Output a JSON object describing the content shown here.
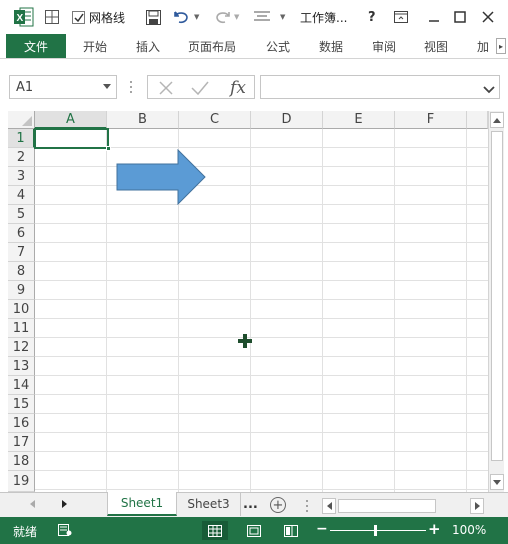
{
  "titlebar": {
    "gridlines_checkbox_label": "网格线",
    "gridlines_checked": true,
    "doc_title": "工作簿...",
    "help": "?"
  },
  "ribbon": {
    "tabs": [
      "文件",
      "开始",
      "插入",
      "页面布局",
      "公式",
      "数据",
      "审阅",
      "视图",
      "加"
    ]
  },
  "formula_bar": {
    "name_box": "A1",
    "fx_label": "fx",
    "formula": ""
  },
  "grid": {
    "columns": [
      "A",
      "B",
      "C",
      "D",
      "E",
      "F"
    ],
    "rows": [
      "1",
      "2",
      "3",
      "4",
      "5",
      "6",
      "7",
      "8",
      "9",
      "10",
      "11",
      "12",
      "13",
      "14",
      "15",
      "16",
      "17",
      "18",
      "19"
    ],
    "selected_cell": "A1",
    "shape": "right-arrow",
    "shape_color": "#5b9bd5"
  },
  "sheets": {
    "tabs": [
      "Sheet1",
      "Sheet3"
    ],
    "active": "Sheet1",
    "more": "..."
  },
  "status": {
    "text": "就绪",
    "zoom": "100%"
  },
  "colors": {
    "accent": "#217346",
    "shape": "#5b9bd5"
  }
}
